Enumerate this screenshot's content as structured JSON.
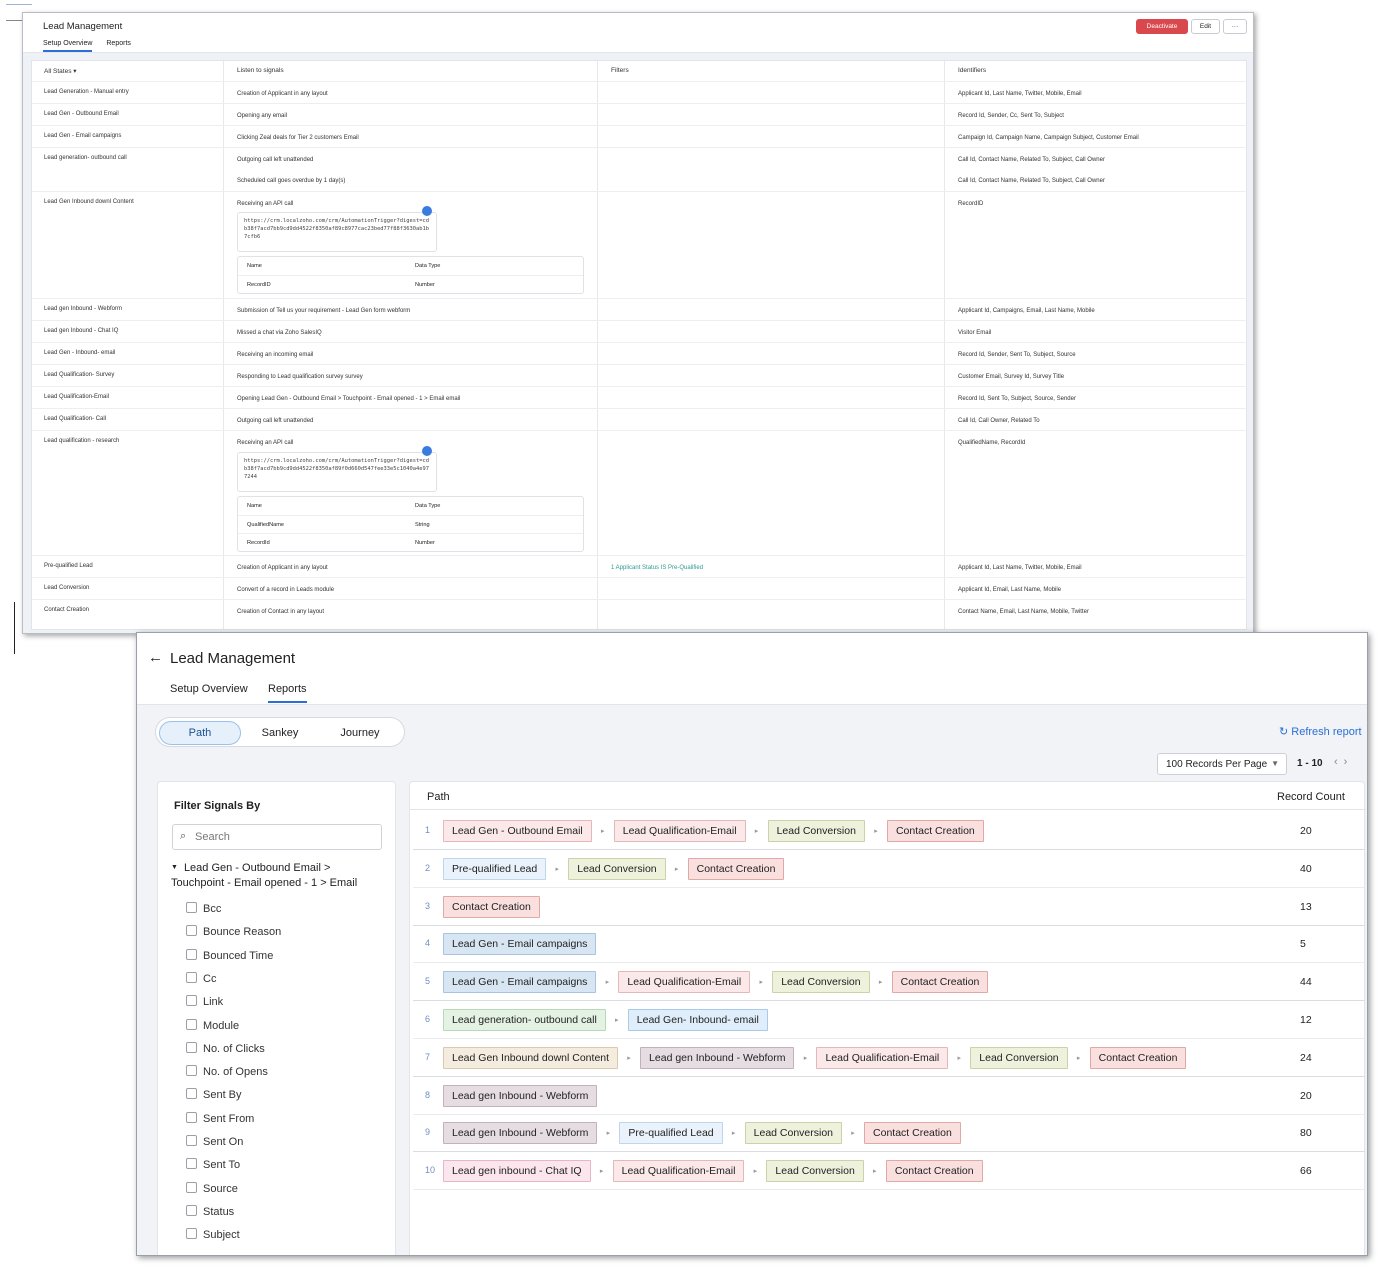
{
  "colors": {
    "accent": "#2b6fd6",
    "deactivate": "#d9484c",
    "link_green": "#2e9b8f"
  },
  "window1": {
    "title": "Lead Management",
    "tabs": [
      "Setup Overview",
      "Reports"
    ],
    "buttons": {
      "deactivate": "Deactivate",
      "edit": "Edit",
      "more": "···"
    },
    "headers": {
      "states": "All States",
      "listen": "Listen to signals",
      "filters": "Filters",
      "identifiers": "Identifiers"
    },
    "rows": [
      {
        "state": "Lead Generation - Manual entry",
        "listen": "Creation of Applicant in any layout",
        "filter": "",
        "ident": "Applicant Id, Last Name, Twitter, Mobile, Email"
      },
      {
        "state": "Lead Gen - Outbound Email",
        "listen": "Opening any email",
        "filter": "",
        "ident": "Record Id, Sender, Cc, Sent To, Subject"
      },
      {
        "state": "Lead Gen - Email campaigns",
        "listen": "Clicking Zeal deals for Tier 2 customers Email",
        "filter": "",
        "ident": "Campaign Id, Campaign Name, Campaign Subject, Customer Email"
      },
      {
        "state": "Lead generation- outbound call",
        "listen": "Outgoing call left unattended",
        "filter": "",
        "ident": "Call Id, Contact Name, Related To, Subject, Call Owner"
      },
      {
        "state": "",
        "listen": "Scheduled call goes overdue by 1 day(s)",
        "filter": "",
        "ident": "Call Id, Contact Name, Related To, Subject, Call Owner"
      },
      {
        "state": "Lead Gen Inbound downl Content",
        "listen": "Receiving an API call",
        "filter": "",
        "ident": "RecordID"
      },
      {
        "state": "Lead gen Inbound - Webform",
        "listen": "Submission of Tell us your requirement - Lead Gen form webform",
        "filter": "",
        "ident": "Applicant Id, Campaigns, Email, Last Name, Mobile"
      },
      {
        "state": "Lead gen Inbound - Chat IQ",
        "listen": "Missed a chat via Zoho SalesIQ",
        "filter": "",
        "ident": "Visitor Email"
      },
      {
        "state": "Lead Gen - Inbound- email",
        "listen": "Receiving an incoming email",
        "filter": "",
        "ident": "Record Id, Sender, Sent To, Subject, Source"
      },
      {
        "state": "Lead Qualification- Survey",
        "listen": "Responding to Lead qualification survey survey",
        "filter": "",
        "ident": "Customer Email, Survey Id, Survey Title"
      },
      {
        "state": "Lead Qualification-Email",
        "listen": "Opening Lead Gen - Outbound Email > Touchpoint - Email opened - 1 > Email email",
        "filter": "",
        "ident": "Record Id, Sent To, Subject, Source, Sender"
      },
      {
        "state": "Lead Qualification- Call",
        "listen": "Outgoing call left unattended",
        "filter": "",
        "ident": "Call Id, Call Owner, Related To"
      },
      {
        "state": "Lead qualification - research",
        "listen": "Receiving an API call",
        "filter": "",
        "ident": "QualifiedName, RecordId"
      },
      {
        "state": "Pre-qualified Lead",
        "listen": "Creation of Applicant in any layout",
        "filter": "1  Applicant Status  IS  Pre-Qualified",
        "ident": "Applicant Id, Last Name, Twitter, Mobile, Email"
      },
      {
        "state": "Lead Conversion",
        "listen": "Convert of a record in Leads module",
        "filter": "",
        "ident": "Applicant Id, Email, Last Name, Mobile"
      },
      {
        "state": "Contact Creation",
        "listen": "Creation of Contact in any layout",
        "filter": "",
        "ident": "Contact Name, Email, Last Name, Mobile, Twitter"
      }
    ],
    "api1": {
      "url": "https://crm.localzoho.com/crm/AutomationTrigger?digest=cdb38f7acd7bb9cd9dd4522f8350af89c8977cac23bed77f88f3630ab1b7cfb6",
      "h1": "Name",
      "h2": "Data Type",
      "params": [
        [
          "RecordID",
          "Number"
        ]
      ]
    },
    "api2": {
      "url": "https://crm.localzoho.com/crm/AutomationTrigger?digest=cdb38f7acd7bb9cd9dd4522f8350af89f0d660d547fee33e5c1040a4e977244",
      "h1": "Name",
      "h2": "Data Type",
      "params": [
        [
          "QualifiedName",
          "String"
        ],
        [
          "RecordId",
          "Number"
        ]
      ]
    }
  },
  "window2": {
    "title": "Lead Management",
    "tabs": [
      "Setup Overview",
      "Reports"
    ],
    "segments": [
      "Path",
      "Sankey",
      "Journey"
    ],
    "refresh": "Refresh report",
    "per_page": "100 Records Per Page",
    "range": "1 - 10",
    "filter_title": "Filter Signals By",
    "search_placeholder": "Search",
    "group": "Lead Gen - Outbound Email > Touchpoint - Email opened - 1 > Email",
    "fields": [
      "Bcc",
      "Bounce Reason",
      "Bounced Time",
      "Cc",
      "Link",
      "Module",
      "No. of Clicks",
      "No. of Opens",
      "Sent By",
      "Sent From",
      "Sent On",
      "Sent To",
      "Source",
      "Status",
      "Subject"
    ],
    "col_path": "Path",
    "col_count": "Record Count",
    "paths": [
      {
        "n": "1",
        "steps": [
          "Lead Gen - Outbound Email",
          "Lead Qualification-Email",
          "Lead Conversion",
          "Contact Creation"
        ],
        "count": "20"
      },
      {
        "n": "2",
        "steps": [
          "Pre-qualified Lead",
          "Lead Conversion",
          "Contact Creation"
        ],
        "count": "40"
      },
      {
        "n": "3",
        "steps": [
          "Contact Creation"
        ],
        "count": "13"
      },
      {
        "n": "4",
        "steps": [
          "Lead Gen - Email campaigns"
        ],
        "count": "5"
      },
      {
        "n": "5",
        "steps": [
          "Lead Gen - Email campaigns",
          "Lead Qualification-Email",
          "Lead Conversion",
          "Contact Creation"
        ],
        "count": "44"
      },
      {
        "n": "6",
        "steps": [
          "Lead generation- outbound call",
          "Lead Gen- Inbound- email"
        ],
        "count": "12"
      },
      {
        "n": "7",
        "steps": [
          "Lead Gen Inbound downl Content",
          "Lead gen Inbound - Webform",
          "Lead Qualification-Email",
          "Lead Conversion",
          "Contact Creation"
        ],
        "count": "24"
      },
      {
        "n": "8",
        "steps": [
          "Lead gen Inbound - Webform"
        ],
        "count": "20"
      },
      {
        "n": "9",
        "steps": [
          "Lead gen Inbound - Webform",
          "Pre-qualified Lead",
          "Lead Conversion",
          "Contact Creation"
        ],
        "count": "80"
      },
      {
        "n": "10",
        "steps": [
          "Lead gen inbound - Chat IQ",
          "Lead Qualification-Email",
          "Lead Conversion",
          "Contact Creation"
        ],
        "count": "66"
      }
    ]
  }
}
